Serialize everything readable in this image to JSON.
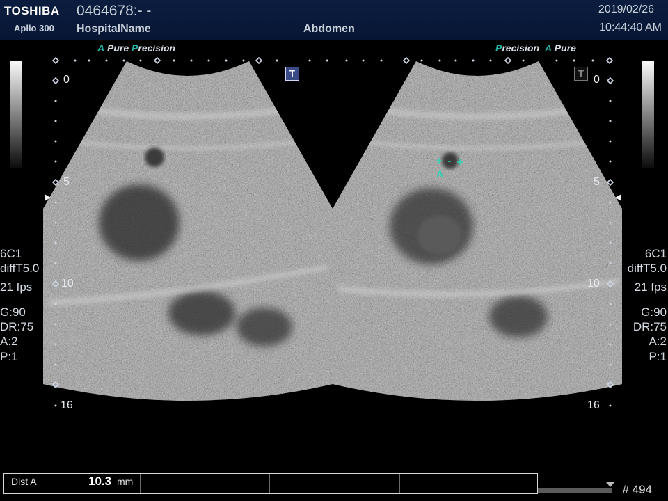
{
  "header": {
    "brand": "TOSHIBA",
    "model": "Aplio 300",
    "patient_id": "0464678:- -",
    "hospital": "HospitalName",
    "exam": "Abdomen",
    "date": "2019/02/26",
    "time": "10:44:40 AM"
  },
  "left_image": {
    "tags": {
      "a": "A",
      "pure": "Pure",
      "p": "P",
      "recision": "recision"
    },
    "depth_labels": {
      "d0": "0",
      "d5": "5",
      "d10": "10",
      "d16": "16"
    },
    "params": {
      "probe": "6C1",
      "filter": "diffT5.0",
      "fps": "21 fps",
      "gain": "G:90",
      "dr": "DR:75",
      "a": "A:2",
      "p": "P:1"
    }
  },
  "right_image": {
    "tags": {
      "p": "P",
      "recision": "recision",
      "a": "A",
      "pure": "Pure"
    },
    "depth_labels": {
      "d0": "0",
      "d5": "5",
      "d10": "10",
      "d16": "16"
    },
    "caliper_label": "A",
    "params": {
      "probe": "6C1",
      "filter": "diffT5.0",
      "fps": "21 fps",
      "gain": "G:90",
      "dr": "DR:75",
      "a": "A:2",
      "p": "P:1"
    }
  },
  "t_icon": "T",
  "measurement": {
    "label": "Dist A",
    "value": "10.3",
    "unit": "mm"
  },
  "frame_counter": "# 494",
  "colors": {
    "header_bg": "#0b1d3f",
    "accent_teal": "#24b6a8",
    "caliper": "#2fd3b4"
  },
  "icons": [
    "t-icon",
    "scale-marker-icon",
    "caliper-icon",
    "focus-arrow-icon"
  ]
}
